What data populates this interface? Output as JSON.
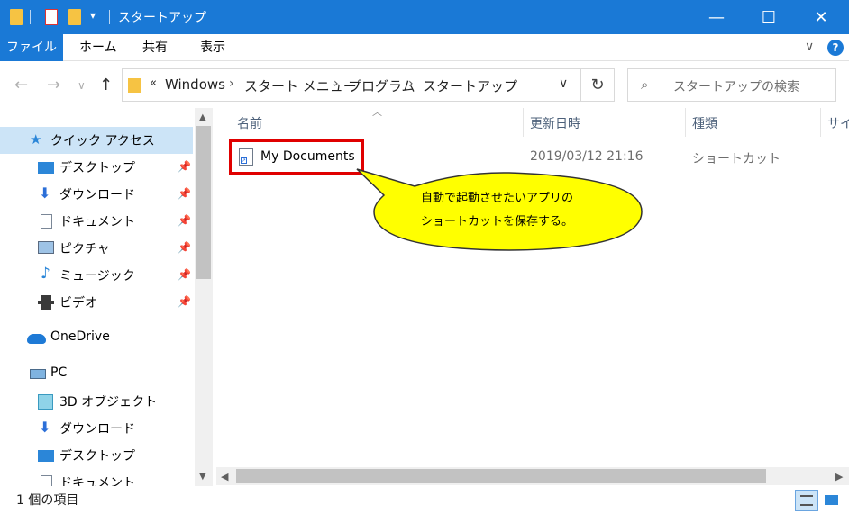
{
  "window": {
    "title": "スタートアップ",
    "minimize_glyph": "—",
    "maximize_glyph": "☐",
    "close_glyph": "✕",
    "qat_dropdown": "▾"
  },
  "ribbon": {
    "tabs": [
      "ファイル",
      "ホーム",
      "共有",
      "表示"
    ],
    "expand_glyph": "∨",
    "help_glyph": "?"
  },
  "address": {
    "back": "←",
    "forward": "→",
    "recent": "∨",
    "up": "↑",
    "overflow": "«",
    "crumbs": [
      "Windows",
      "スタート メニュー",
      "プログラム",
      "スタートアップ"
    ],
    "separator": "›",
    "dropdown": "∨",
    "refresh": "↻"
  },
  "search": {
    "placeholder": "スタートアップの検索",
    "icon": "⌕"
  },
  "nav": {
    "quick_access": "クイック アクセス",
    "items": [
      {
        "label": "デスクトップ",
        "icon": "desktop-icon"
      },
      {
        "label": "ダウンロード",
        "icon": "download-icon"
      },
      {
        "label": "ドキュメント",
        "icon": "document-icon"
      },
      {
        "label": "ピクチャ",
        "icon": "pictures-icon"
      },
      {
        "label": "ミュージック",
        "icon": "music-icon"
      },
      {
        "label": "ビデオ",
        "icon": "video-icon"
      }
    ],
    "onedrive": "OneDrive",
    "pc": "PC",
    "pc_items": [
      {
        "label": "3D オブジェクト",
        "icon": "3d-objects-icon"
      },
      {
        "label": "ダウンロード",
        "icon": "download-icon"
      },
      {
        "label": "デスクトップ",
        "icon": "desktop-icon"
      },
      {
        "label": "ドキュメント",
        "icon": "document-icon"
      }
    ],
    "pin_glyph": "📌"
  },
  "columns": {
    "name": "名前",
    "modified": "更新日時",
    "type": "種類",
    "size": "サイ"
  },
  "files": [
    {
      "name": "My Documents",
      "modified": "2019/03/12 21:16",
      "type": "ショートカット"
    }
  ],
  "callout": {
    "line1": "自動で起動させたいアプリの",
    "line2": "ショートカットを保存する。"
  },
  "status": {
    "text": "1 個の項目"
  },
  "colors": {
    "accent": "#1a79d6",
    "highlight_border": "#e00000",
    "callout_fill": "#ffff00"
  }
}
